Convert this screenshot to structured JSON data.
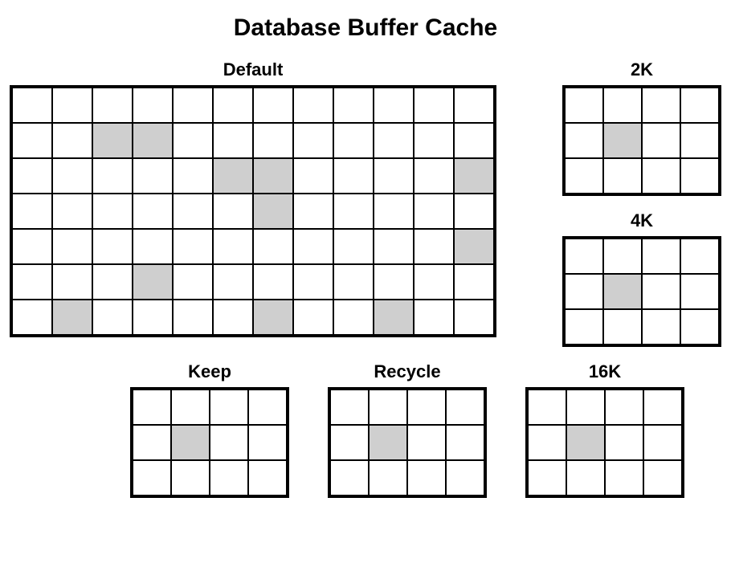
{
  "title": "Database Buffer Cache",
  "pools": {
    "default": {
      "label": "Default",
      "cols": 12,
      "rows": 7,
      "filled": [
        [
          1,
          2
        ],
        [
          1,
          3
        ],
        [
          2,
          5
        ],
        [
          2,
          6
        ],
        [
          2,
          11
        ],
        [
          3,
          6
        ],
        [
          4,
          11
        ],
        [
          5,
          3
        ],
        [
          6,
          1
        ],
        [
          6,
          6
        ],
        [
          6,
          9
        ]
      ]
    },
    "k2": {
      "label": "2K",
      "cols": 4,
      "rows": 3,
      "filled": [
        [
          1,
          1
        ]
      ]
    },
    "k4": {
      "label": "4K",
      "cols": 4,
      "rows": 3,
      "filled": [
        [
          1,
          1
        ]
      ]
    },
    "k16": {
      "label": "16K",
      "cols": 4,
      "rows": 3,
      "filled": [
        [
          1,
          1
        ]
      ]
    },
    "keep": {
      "label": "Keep",
      "cols": 4,
      "rows": 3,
      "filled": [
        [
          1,
          1
        ]
      ]
    },
    "recycle": {
      "label": "Recycle",
      "cols": 4,
      "rows": 3,
      "filled": [
        [
          1,
          1
        ]
      ]
    }
  }
}
